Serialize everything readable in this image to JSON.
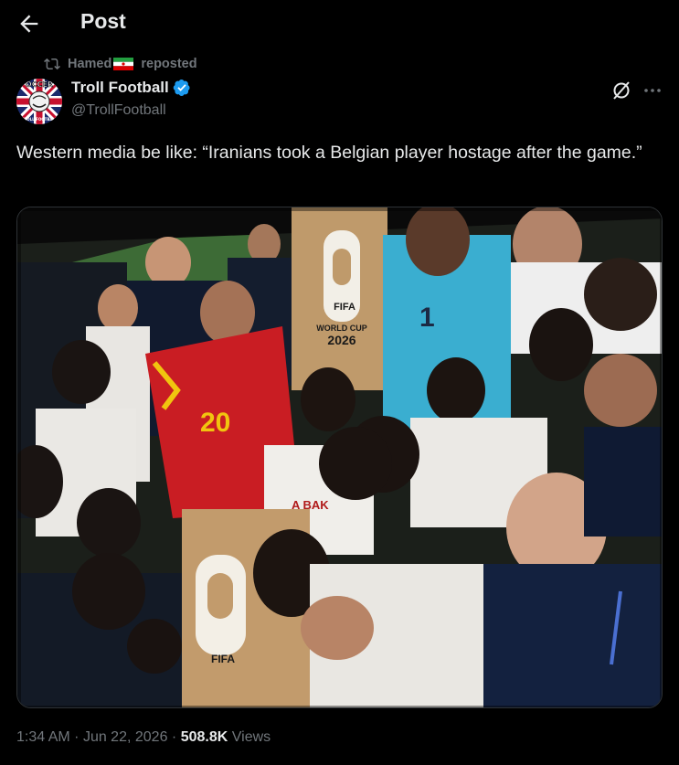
{
  "header": {
    "title": "Post"
  },
  "repost": {
    "user": "Hamed",
    "suffix": "reposted"
  },
  "author": {
    "name": "Troll Football",
    "handle": "@TrollFootball",
    "avatar_text_top": "OCCER",
    "avatar_text_bottom": "TROLL FOOTBALL"
  },
  "tweet": {
    "text": "Western media be like: “Iranians took a Belgian player hostage after the game.”"
  },
  "media": {
    "fifa_top": "FIFA",
    "world_cup": "WORLD CUP",
    "year": "2026",
    "fifa_bottom": "FIFA",
    "jersey_number_red": "20",
    "jersey_number_blue": "1",
    "jersey_name": "A   BAK"
  },
  "meta": {
    "time": "1:34 AM",
    "date": "Jun 22, 2026",
    "views_count": "508.8K",
    "views_label": "Views",
    "separator": "·"
  },
  "colors": {
    "background": "#000000",
    "text": "#e7e9ea",
    "muted": "#71767b",
    "verified": "#1d9bf0"
  }
}
